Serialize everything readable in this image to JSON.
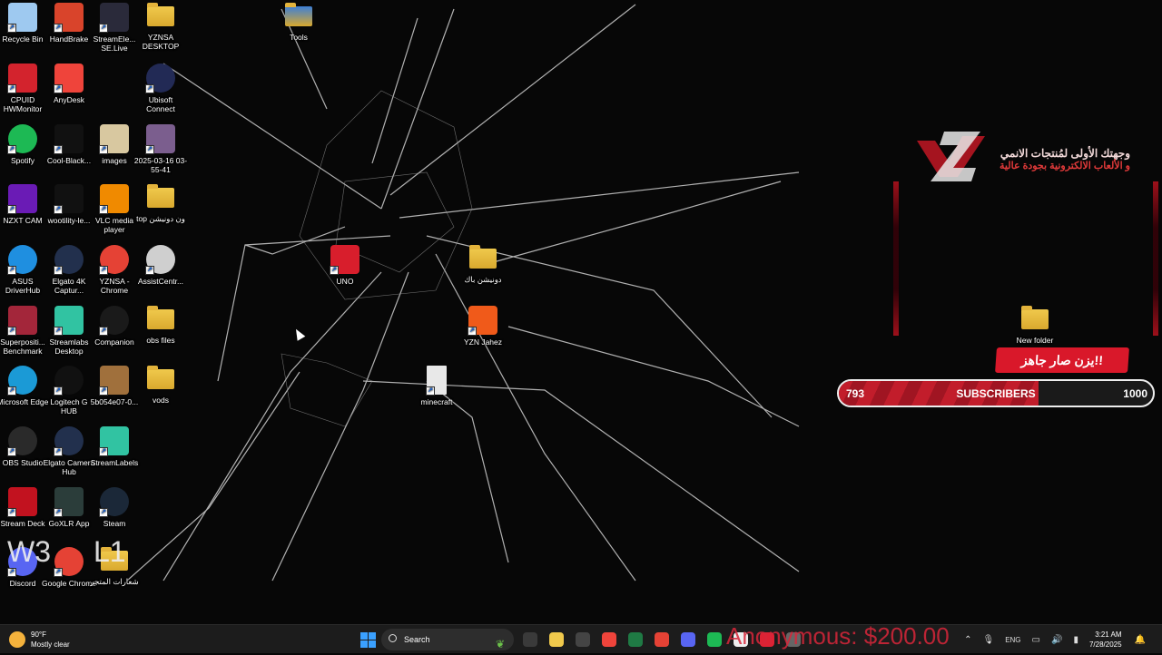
{
  "desktop_icons": [
    {
      "label": "Recycle Bin",
      "icon": "recycle-bin-icon",
      "color": "#9ec9f0"
    },
    {
      "label": "HandBrake",
      "icon": "handbrake-icon",
      "color": "#d9442b"
    },
    {
      "label": "StreamEle... SE.Live",
      "icon": "streamelements-icon",
      "color": "#2a2a3a"
    },
    {
      "label": "YZNSA DESKTOP",
      "icon": "folder-icon",
      "color": "#f0c94c"
    },
    {
      "label": "Tools",
      "icon": "folder-icon",
      "color": "#3d7fd6"
    },
    {
      "label": "CPUID HWMonitor",
      "icon": "hwmonitor-icon",
      "color": "#d3232d"
    },
    {
      "label": "AnyDesk",
      "icon": "anydesk-icon",
      "color": "#ef443b"
    },
    {
      "label": "Ubisoft Connect",
      "icon": "ubisoft-icon",
      "color": "#222a55"
    },
    {
      "label": "Spotify",
      "icon": "spotify-icon",
      "color": "#1db954"
    },
    {
      "label": "Cool-Black...",
      "icon": "image-file-icon",
      "color": "#111111"
    },
    {
      "label": "images",
      "icon": "image-file-icon",
      "color": "#d8c8a0"
    },
    {
      "label": "2025-03-16 03-55-41",
      "icon": "video-file-icon",
      "color": "#7b5e8e"
    },
    {
      "label": "NZXT CAM",
      "icon": "nzxt-cam-icon",
      "color": "#6a1bb5"
    },
    {
      "label": "wootility-le...",
      "icon": "wooting-icon",
      "color": "#111111"
    },
    {
      "label": "VLC media player",
      "icon": "vlc-icon",
      "color": "#f08a00"
    },
    {
      "label": "top ون دونيشن",
      "icon": "folder-icon",
      "color": "#f0c94c"
    },
    {
      "label": "ASUS DriverHub",
      "icon": "asus-driverhub-icon",
      "color": "#1f8fe0"
    },
    {
      "label": "Elgato 4K Captur...",
      "icon": "elgato-4k-icon",
      "color": "#22304d"
    },
    {
      "label": "YZNSA - Chrome",
      "icon": "chrome-icon",
      "color": "#e54235"
    },
    {
      "label": "AssistCentr...",
      "icon": "assistcentre-icon",
      "color": "#cfcfcf"
    },
    {
      "label": "UNO",
      "icon": "uno-icon",
      "color": "#d81e2c"
    },
    {
      "label": "دونيشن باك",
      "icon": "folder-icon",
      "color": "#f0c94c"
    },
    {
      "label": "Superpositi... Benchmark",
      "icon": "superposition-icon",
      "color": "#a3263a"
    },
    {
      "label": "Streamlabs Desktop",
      "icon": "streamlabs-icon",
      "color": "#31c3a2"
    },
    {
      "label": "Companion",
      "icon": "companion-icon",
      "color": "#1a1a1a"
    },
    {
      "label": "obs files",
      "icon": "folder-icon",
      "color": "#f0c94c"
    },
    {
      "label": "YZN Jahez",
      "icon": "video-file-icon",
      "color": "#f05a1a"
    },
    {
      "label": "New folder",
      "icon": "folder-icon",
      "color": "#f0c94c"
    },
    {
      "label": "Microsoft Edge",
      "icon": "edge-icon",
      "color": "#1b9ad6"
    },
    {
      "label": "Logitech G HUB",
      "icon": "logitech-ghub-icon",
      "color": "#111111"
    },
    {
      "label": "5b054e07-0...",
      "icon": "image-file-icon",
      "color": "#a0703c"
    },
    {
      "label": "vods",
      "icon": "folder-icon",
      "color": "#f0c94c"
    },
    {
      "label": "minecraft",
      "icon": "text-file-icon",
      "color": "#e8e8e8"
    },
    {
      "label": "OBS Studio",
      "icon": "obs-icon",
      "color": "#2a2a2a"
    },
    {
      "label": "Elgato Camera Hub",
      "icon": "elgato-camera-hub-icon",
      "color": "#22304d"
    },
    {
      "label": "StreamLabels",
      "icon": "streamlabels-icon",
      "color": "#31c3a2"
    },
    {
      "label": "Stream Deck",
      "icon": "stream-deck-icon",
      "color": "#c2121f"
    },
    {
      "label": "GoXLR App",
      "icon": "goxlr-icon",
      "color": "#2b3d3a"
    },
    {
      "label": "Steam",
      "icon": "steam-icon",
      "color": "#1b2838"
    },
    {
      "label": "Discord",
      "icon": "discord-icon",
      "color": "#5865f2"
    },
    {
      "label": "Google Chrome",
      "icon": "chrome-icon",
      "color": "#e54235"
    },
    {
      "label": "شعارات المتجر",
      "icon": "folder-icon",
      "color": "#f0c94c"
    }
  ],
  "overlay": {
    "text_line1": "وجهتك الأولى لمُنتجات الانمي",
    "text_line2": "و الألعاب الالكترونية بجودة عالية",
    "ready_badge": "يزن صار جاهز!!",
    "subscribers": {
      "current": "793",
      "label": "SUBSCRIBERS",
      "goal": "1000",
      "progress": 0.793
    },
    "accent": "#d9182a"
  },
  "stray_text": {
    "w3": "W3",
    "l1": "L1"
  },
  "donation_alert": "Anonymous: $200.00",
  "taskbar": {
    "weather": {
      "temp": "90°F",
      "condition": "Mostly clear"
    },
    "search_placeholder": "Search",
    "pinned": [
      "task-view-icon",
      "file-explorer-icon",
      "obs-icon",
      "anydesk-icon",
      "excel-icon",
      "chrome-icon",
      "discord-icon",
      "spotify-icon",
      "stream-deck-icon",
      "mail-icon",
      "calculator-icon"
    ],
    "tray": {
      "language": "ENG",
      "time": "3:21 AM",
      "date": "7/28/2025"
    }
  }
}
